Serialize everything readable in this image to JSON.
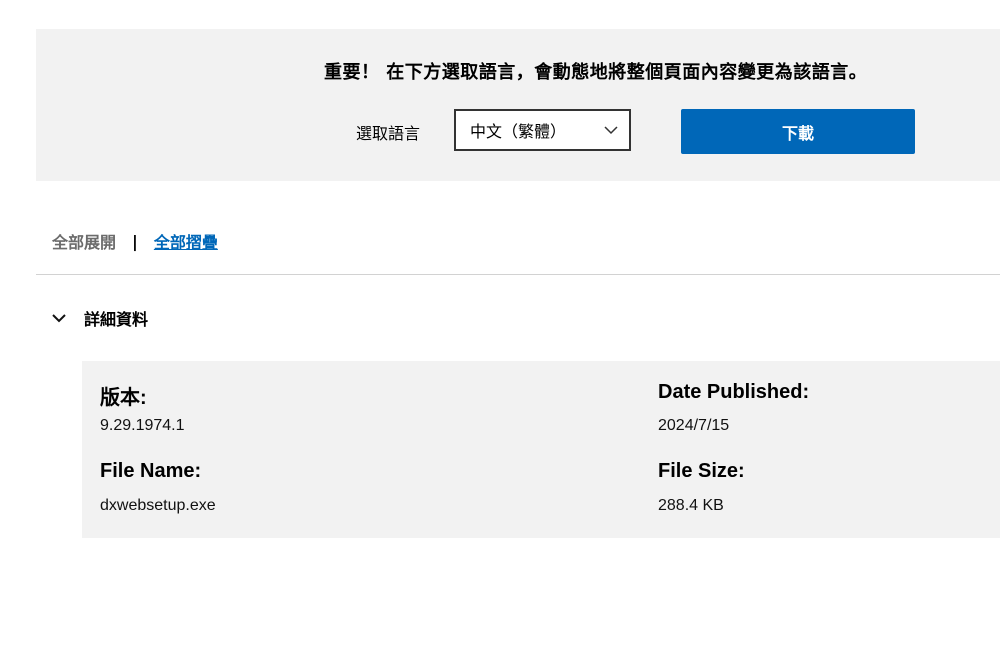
{
  "banner": {
    "notice": "重要！ 在下方選取語言，會動態地將整個頁面內容變更為該語言。",
    "language_label": "選取語言",
    "language_selected": "中文（繁體）",
    "download_label": "下載"
  },
  "controls": {
    "expand_all": "全部展開",
    "separator": "|",
    "collapse_all": "全部摺疊"
  },
  "details": {
    "title": "詳細資料",
    "version_label": "版本:",
    "version_value": "9.29.1974.1",
    "date_label": "Date Published:",
    "date_value": "2024/7/15",
    "filename_label": "File Name:",
    "filename_value": "dxwebsetup.exe",
    "filesize_label": "File Size:",
    "filesize_value": "288.4 KB"
  },
  "icons": {
    "select_chevron": "chevron-down-icon",
    "details_chevron": "chevron-down-icon"
  },
  "colors": {
    "accent": "#0067b8",
    "panel_bg": "#f2f2f2"
  }
}
